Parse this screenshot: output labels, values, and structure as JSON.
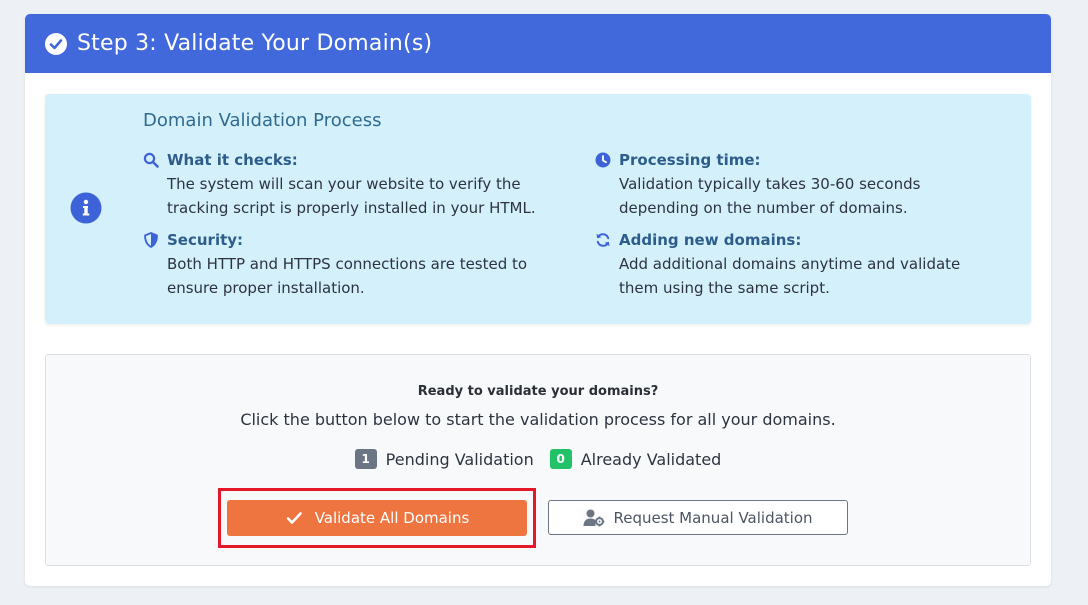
{
  "header": {
    "title": "Step 3: Validate Your Domain(s)",
    "icon": "check-circle-icon"
  },
  "info": {
    "title": "Domain Validation Process",
    "icon": "info-circle-icon",
    "features": [
      {
        "icon": "search-icon",
        "label": "What it checks:",
        "line1": "The system will scan your website to verify the",
        "line2": "tracking script is properly installed in your HTML."
      },
      {
        "icon": "shield-icon",
        "label": "Security:",
        "line1": "Both HTTP and HTTPS connections are tested to",
        "line2": "ensure proper installation."
      },
      {
        "icon": "clock-icon",
        "label": "Processing time:",
        "line1": "Validation typically takes 30-60 seconds",
        "line2": "depending on the number of domains."
      },
      {
        "icon": "sync-icon",
        "label": "Adding new domains:",
        "line1": "Add additional domains anytime and validate",
        "line2": "them using the same script."
      }
    ]
  },
  "action": {
    "ready_text": "Ready to validate your domains?",
    "instruction": "Click the button below to start the validation process for all your domains.",
    "pending": {
      "count": "1",
      "label": "Pending Validation"
    },
    "validated": {
      "count": "0",
      "label": "Already Validated"
    },
    "validate_button": "Validate All Domains",
    "manual_button": "Request Manual Validation"
  },
  "colors": {
    "header_bg": "#4169dc",
    "info_bg": "#d4f0fb",
    "primary_orange": "#ee7440",
    "success_green": "#22c268",
    "highlight_red": "#e4182a"
  }
}
